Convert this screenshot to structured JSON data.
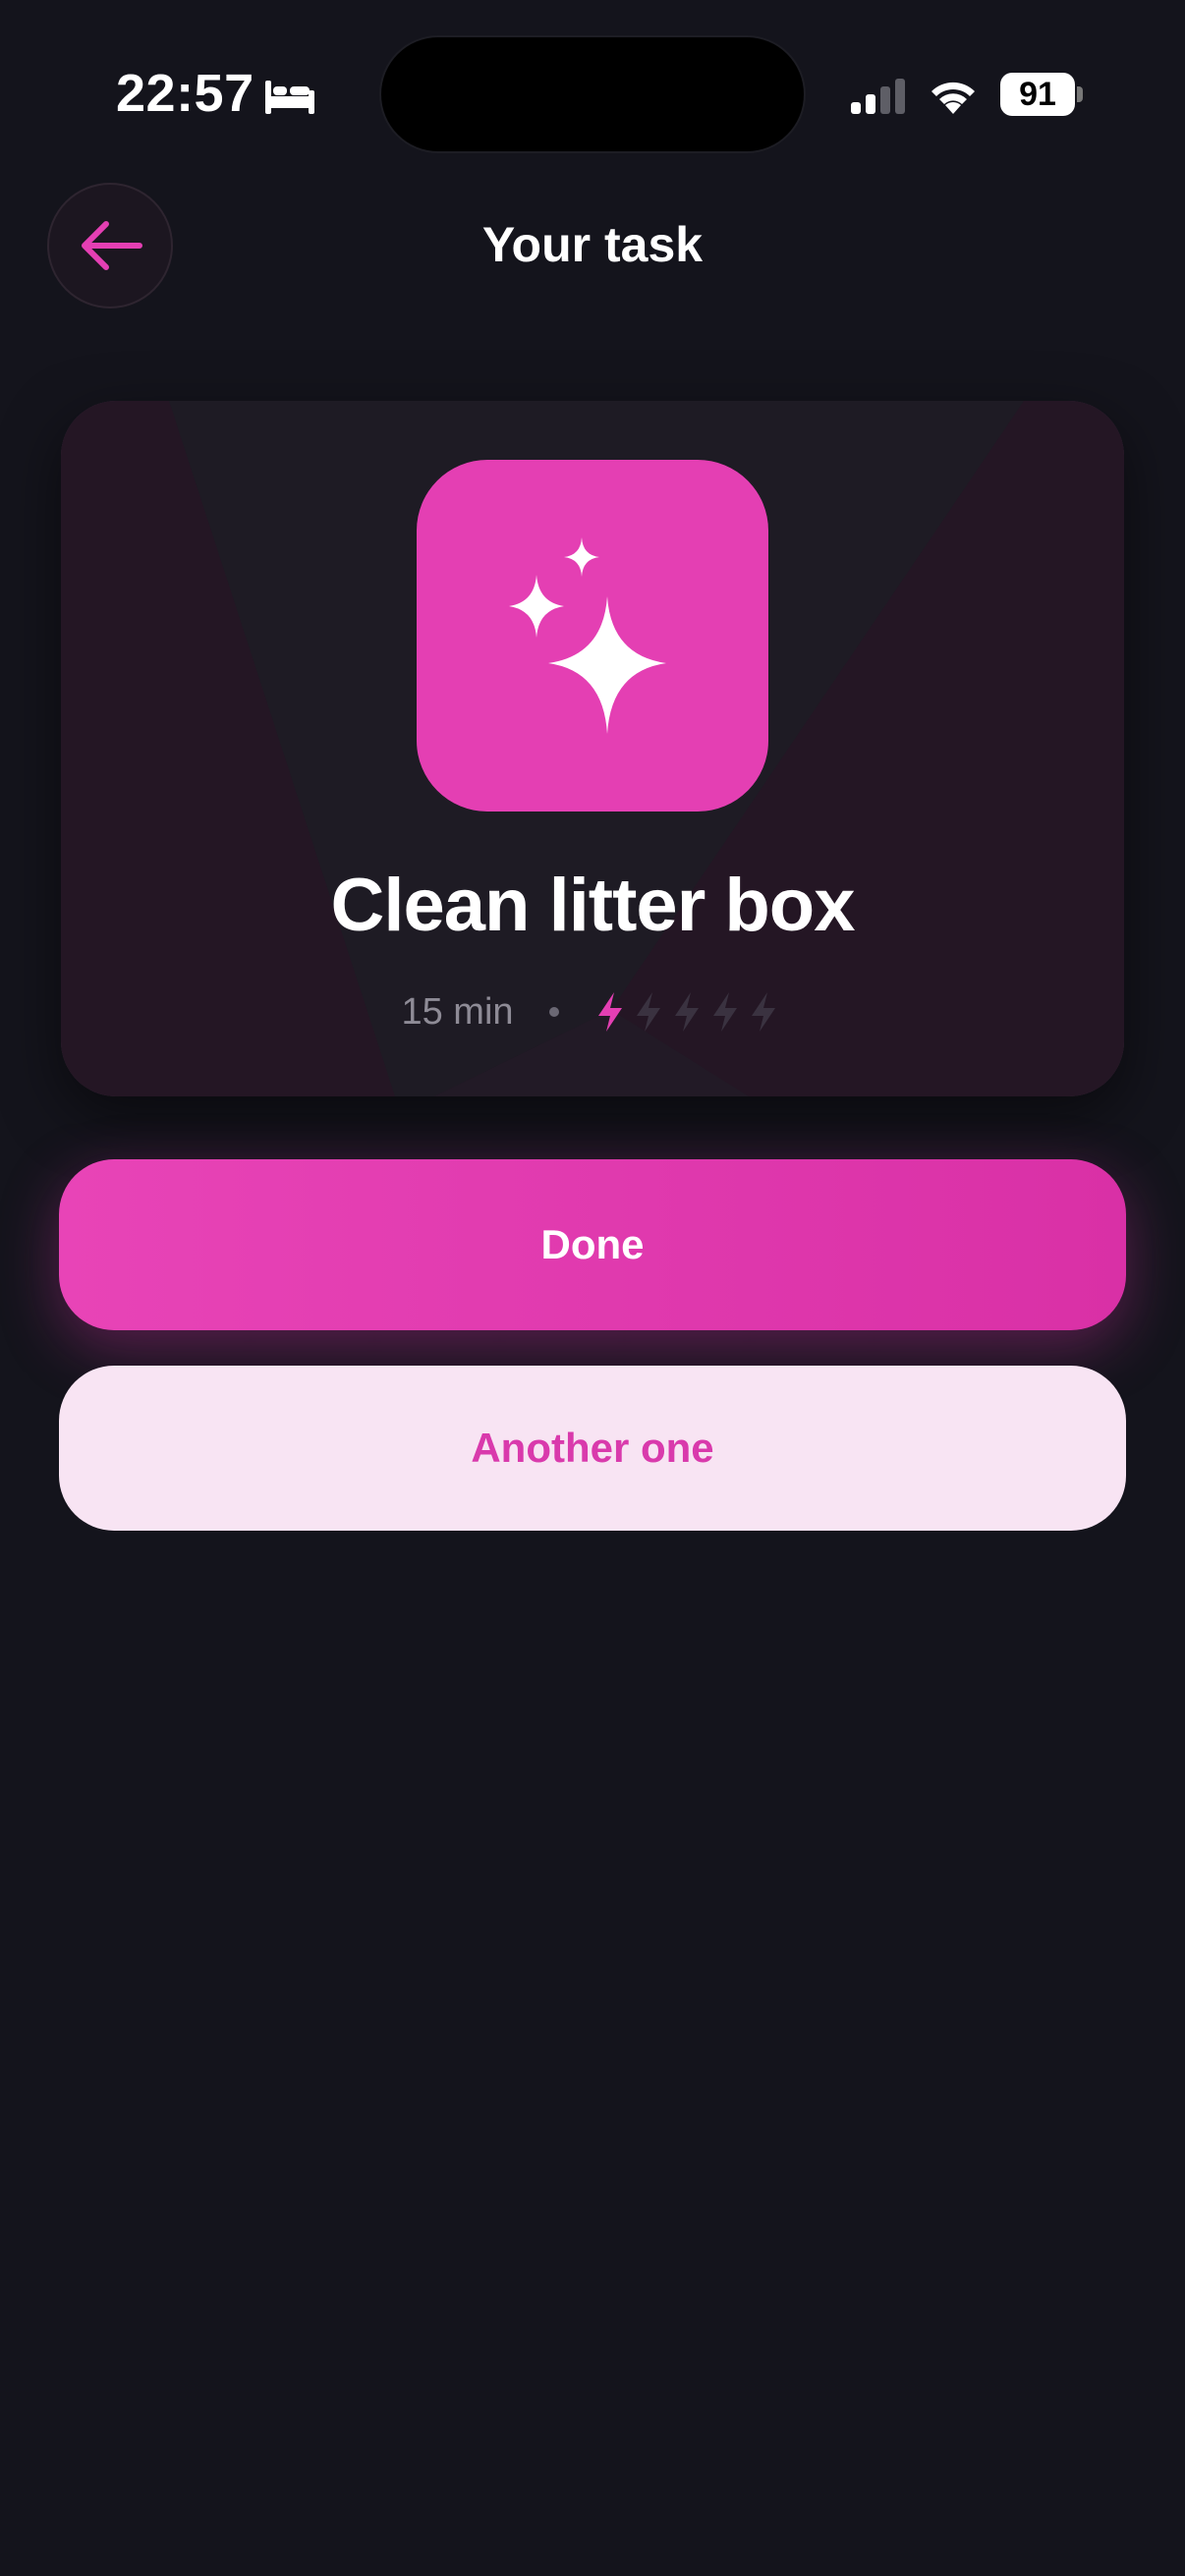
{
  "status_bar": {
    "time": "22:57",
    "battery": "91",
    "icons": [
      "bed-icon",
      "signal-icon",
      "wifi-icon",
      "battery-icon"
    ]
  },
  "header": {
    "back_icon": "arrow-left-icon",
    "title": "Your task"
  },
  "task": {
    "icon": "sparkles-icon",
    "title": "Clean litter box",
    "duration": "15 min",
    "energy_level": 1,
    "energy_max": 5
  },
  "actions": {
    "done_label": "Done",
    "another_label": "Another one"
  },
  "colors": {
    "background": "#14141c",
    "accent": "#e43fb3",
    "secondary_button_bg": "#f8e4f3",
    "muted_text": "#8e8b96",
    "inactive_bolt": "#3a3240"
  }
}
